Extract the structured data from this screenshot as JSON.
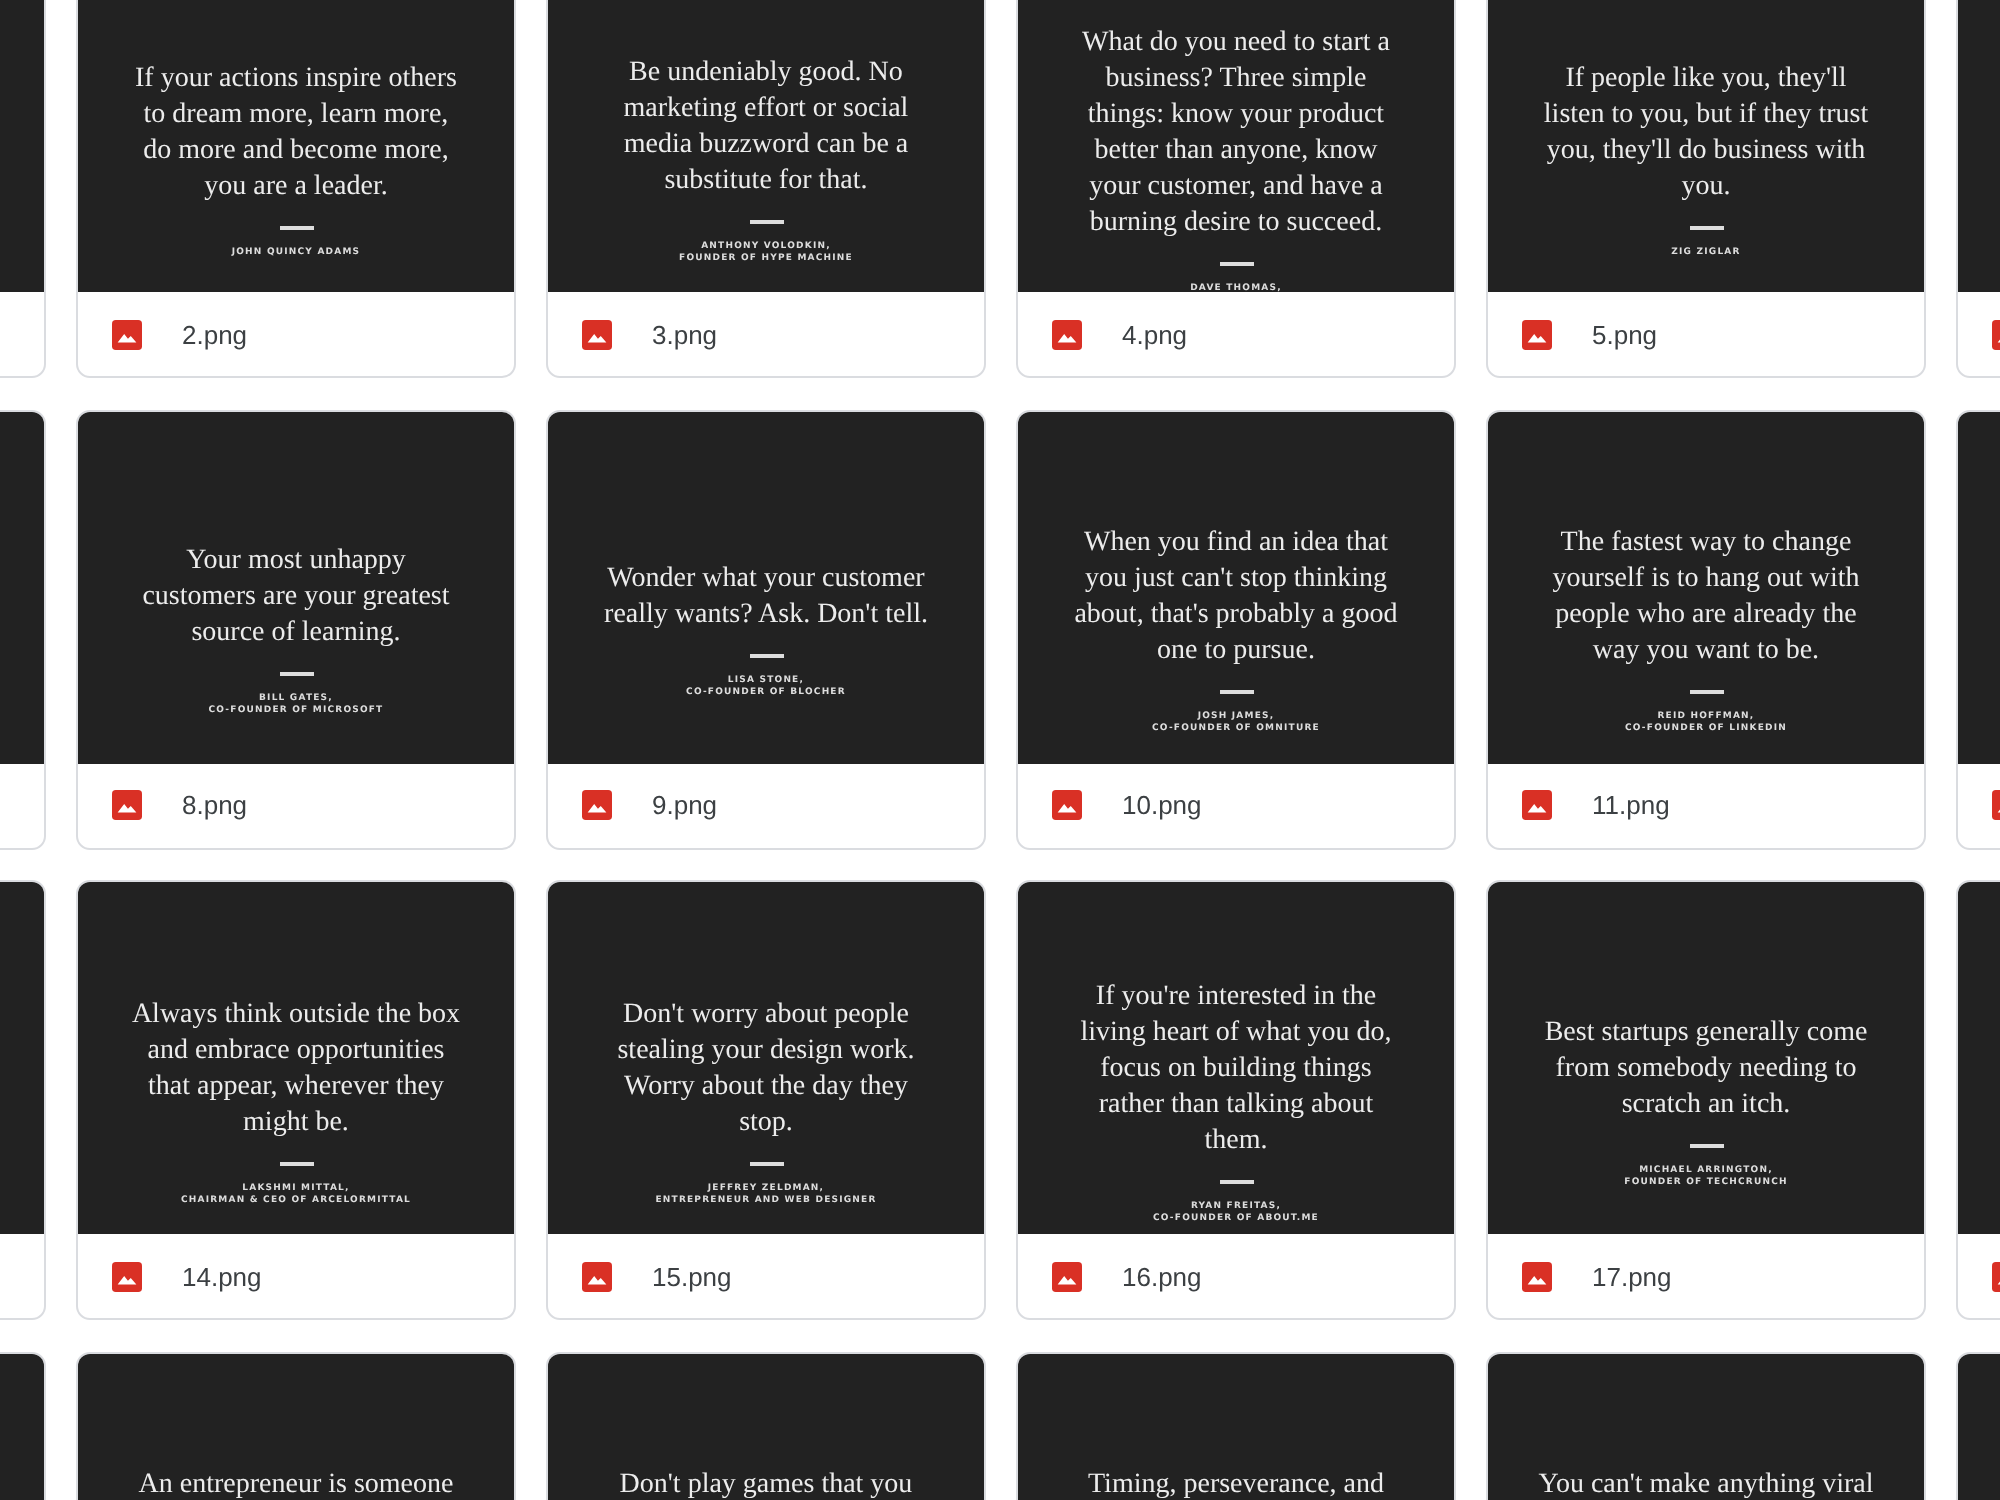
{
  "rows": [
    {
      "cards": [
        {
          "kind": "edge"
        },
        {
          "kind": "file",
          "name": "2.png",
          "quote": "If your actions inspire others\nto dream more, learn more,\ndo more and become more,\nyou are a leader.",
          "attribution": "JOHN QUINCY ADAMS"
        },
        {
          "kind": "file",
          "name": "3.png",
          "quote": "Be undeniably good. No\nmarketing effort or social\nmedia buzzword can be a\nsubstitute for that.",
          "attribution": "ANTHONY VOLODKIN,\nFOUNDER OF HYPE MACHINE"
        },
        {
          "kind": "file",
          "name": "4.png",
          "quote": "What do you need to start a\nbusiness? Three simple\nthings: know your product\nbetter than anyone, know\nyour customer, and have a\nburning desire to succeed.",
          "attribution": "DAVE THOMAS,"
        },
        {
          "kind": "file",
          "name": "5.png",
          "quote": "If people like you, they'll\nlisten to you, but if they trust\nyou, they'll do business with\nyou.",
          "attribution": "ZIG ZIGLAR"
        },
        {
          "kind": "cut"
        }
      ]
    },
    {
      "cards": [
        {
          "kind": "edge"
        },
        {
          "kind": "file",
          "name": "8.png",
          "quote": "Your most unhappy\ncustomers are your greatest\nsource of learning.",
          "attribution": "BILL GATES,\nCO-FOUNDER OF MICROSOFT"
        },
        {
          "kind": "file",
          "name": "9.png",
          "quote": "Wonder what your customer\nreally wants? Ask. Don't tell.",
          "attribution": "LISA STONE,\nCO-FOUNDER OF BLOCHER"
        },
        {
          "kind": "file",
          "name": "10.png",
          "quote": "When you find an idea that\nyou just can't stop thinking\nabout, that's probably a good\none to pursue.",
          "attribution": "JOSH JAMES,\nCO-FOUNDER OF OMNITURE"
        },
        {
          "kind": "file",
          "name": "11.png",
          "quote": "The fastest way to change\nyourself is to hang out with\npeople who are already the\nway you want to be.",
          "attribution": "REID HOFFMAN,\nCO-FOUNDER OF LINKEDIN"
        },
        {
          "kind": "cut"
        }
      ]
    },
    {
      "cards": [
        {
          "kind": "edge"
        },
        {
          "kind": "file",
          "name": "14.png",
          "quote": "Always think outside the box\nand embrace opportunities\nthat appear, wherever they\nmight be.",
          "attribution": "LAKSHMI MITTAL,\nCHAIRMAN & CEO OF ARCELORMITTAL"
        },
        {
          "kind": "file",
          "name": "15.png",
          "quote": "Don't worry about people\nstealing your design work.\nWorry about the day they\nstop.",
          "attribution": "JEFFREY ZELDMAN,\nENTREPRENEUR AND WEB DESIGNER"
        },
        {
          "kind": "file",
          "name": "16.png",
          "quote": "If you're interested in the\nliving heart of what you do,\nfocus on building things\nrather than talking about\nthem.",
          "attribution": "RYAN FREITAS,\nCO-FOUNDER OF ABOUT.ME"
        },
        {
          "kind": "file",
          "name": "17.png",
          "quote": "Best startups generally come\nfrom somebody needing to\nscratch an itch.",
          "attribution": "MICHAEL ARRINGTON,\nFOUNDER OF TECHCRUNCH"
        },
        {
          "kind": "cut"
        }
      ]
    },
    {
      "cards": [
        {
          "kind": "edge"
        },
        {
          "kind": "top",
          "quote": "An entrepreneur is someone"
        },
        {
          "kind": "top",
          "quote": "Don't play games that you"
        },
        {
          "kind": "top",
          "quote": "Timing, perseverance, and"
        },
        {
          "kind": "top",
          "quote": "You can't make anything viral"
        },
        {
          "kind": "cut"
        }
      ]
    }
  ]
}
